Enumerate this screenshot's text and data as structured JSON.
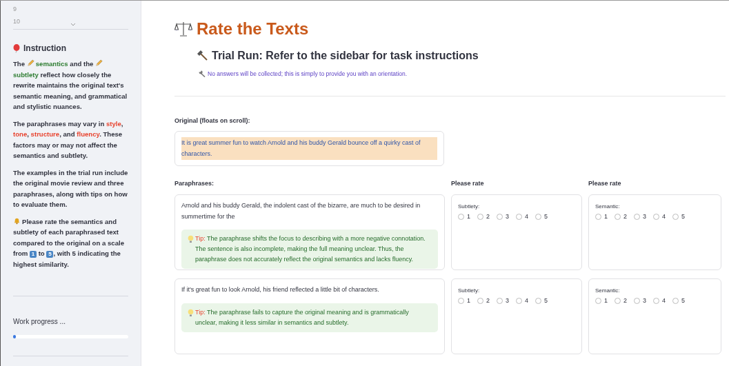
{
  "sidebar": {
    "list_items": [
      "9",
      "10"
    ],
    "instruction": {
      "title": "Instruction",
      "paragraphs": [
        [
          {
            "kind": "text",
            "text": "The "
          },
          {
            "kind": "pencil"
          },
          {
            "kind": "text",
            "text": "semantics",
            "color": "#2e7d32"
          },
          {
            "kind": "text",
            "text": " and the "
          },
          {
            "kind": "pencil"
          },
          {
            "kind": "text",
            "text": "subtlety",
            "color": "#2e7d32"
          },
          {
            "kind": "text",
            "text": " reflect how closely the rewrite maintains the original text's semantic meaning, and grammatical and stylistic nuances."
          }
        ],
        [
          {
            "kind": "text",
            "text": "The paraphrases may vary in "
          },
          {
            "kind": "text",
            "text": "style",
            "color": "#e8432e"
          },
          {
            "kind": "text",
            "text": ", "
          },
          {
            "kind": "text",
            "text": "tone",
            "color": "#e8432e"
          },
          {
            "kind": "text",
            "text": ", "
          },
          {
            "kind": "text",
            "text": "structure",
            "color": "#e8432e"
          },
          {
            "kind": "text",
            "text": ", and "
          },
          {
            "kind": "text",
            "text": "fluency",
            "color": "#e8432e"
          },
          {
            "kind": "text",
            "text": ". These factors may or may not affect the semantics and subtlety."
          }
        ],
        [
          {
            "kind": "text",
            "text": "The examples in the trial run include the original movie review and three paraphrases, along with tips on how to evaluate them."
          }
        ],
        [
          {
            "kind": "bell"
          },
          {
            "kind": "text",
            "text": "Please rate the semantics and subtlety of each paraphrased text compared to the original on a scale from "
          },
          {
            "kind": "keycap",
            "text": "1"
          },
          {
            "kind": "text",
            "text": " to "
          },
          {
            "kind": "keycap",
            "text": "5"
          },
          {
            "kind": "text",
            "text": ", with 5 indicating the highest similarity."
          }
        ]
      ]
    },
    "progress": {
      "label": "Work progress ...",
      "level": 0.01
    }
  },
  "main": {
    "title": "Rate the Texts",
    "subtitle": "Trial Run: Refer to the sidebar for task instructions",
    "caption": "No answers will be collected; this is simply to provide you with an orientation.",
    "original": {
      "label": "Original (floats on scroll):",
      "text": "It is great summer fun to watch Arnold and his buddy Gerald bounce off a quirky cast of characters."
    },
    "columns": [
      "Paraphrases:",
      "Please rate",
      "Please rate"
    ],
    "rows": [
      {
        "paraphrase": "Arnold and his buddy Gerald, the indolent cast of the bizarre, are much to be desired in summertime for the",
        "tip": {
          "label": "Tip:",
          "text": "The paraphrase shifts the focus to describing with a more negative connotation. The sentence is also incomplete, making the full meaning unclear. Thus, the paraphrase does not accurately reflect the original semantics and lacks fluency."
        },
        "ratings": [
          {
            "label": "Subtlety:",
            "options": [
              {
                "label": "1",
                "selected": false
              },
              {
                "label": "2",
                "selected": false
              },
              {
                "label": "3",
                "selected": false
              },
              {
                "label": "4",
                "selected": false
              },
              {
                "label": "5",
                "selected": false
              }
            ]
          },
          {
            "label": "Semantic:",
            "options": [
              {
                "label": "1",
                "selected": false
              },
              {
                "label": "2",
                "selected": false
              },
              {
                "label": "3",
                "selected": false
              },
              {
                "label": "4",
                "selected": false
              },
              {
                "label": "5",
                "selected": false
              }
            ]
          }
        ]
      },
      {
        "paraphrase": "If it's great fun to look Arnold, his friend reflected a little bit of characters.",
        "tip": {
          "label": "Tip:",
          "text": "The paraphrase fails to capture the original meaning and is grammatically unclear, making it less similar in semantics and subtlety."
        },
        "ratings": [
          {
            "label": "Subtlety:",
            "options": [
              {
                "label": "1",
                "selected": false
              },
              {
                "label": "2",
                "selected": false
              },
              {
                "label": "3",
                "selected": false
              },
              {
                "label": "4",
                "selected": false
              },
              {
                "label": "5",
                "selected": false
              }
            ]
          },
          {
            "label": "Semantic:",
            "options": [
              {
                "label": "1",
                "selected": false
              },
              {
                "label": "2",
                "selected": false
              },
              {
                "label": "3",
                "selected": false
              },
              {
                "label": "4",
                "selected": false
              },
              {
                "label": "5",
                "selected": false
              }
            ]
          }
        ]
      }
    ]
  }
}
